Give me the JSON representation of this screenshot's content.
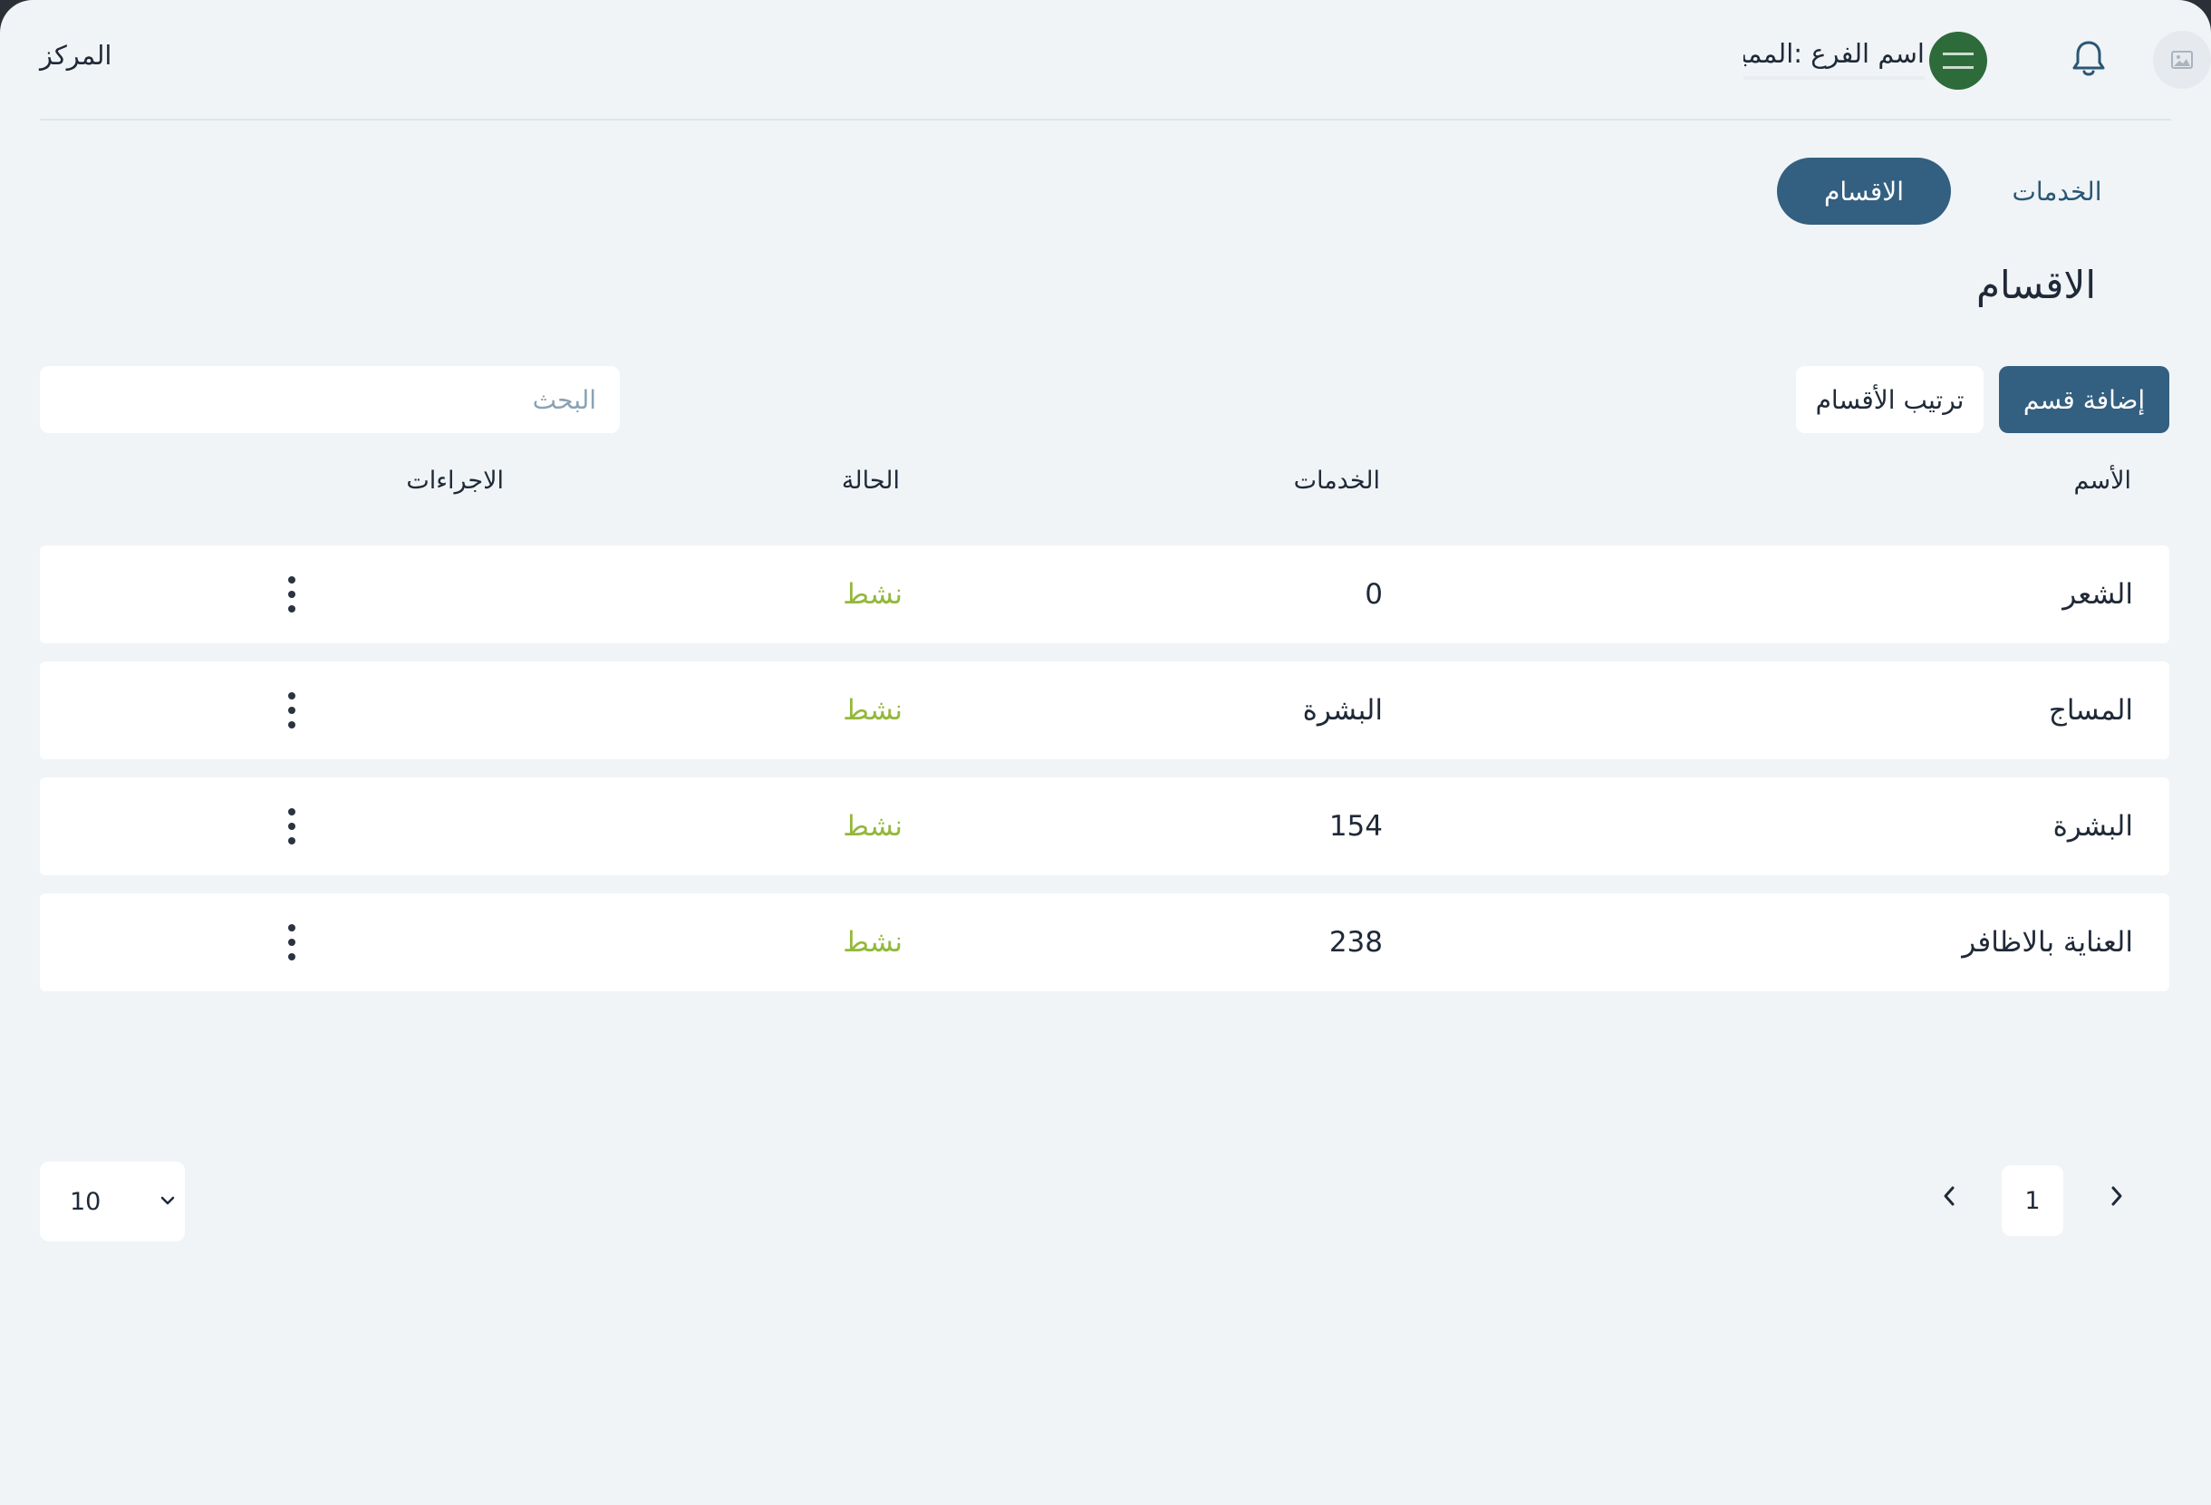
{
  "header": {
    "brand": "المركز",
    "branch_label": "اسم الفرع :المميز",
    "flag_icon": "saudi-flag-icon",
    "notification_icon": "bell-icon",
    "avatar_icon": "image-placeholder-icon"
  },
  "tabs": [
    {
      "label": "الاقسام",
      "active": true
    },
    {
      "label": "الخدمات",
      "active": false
    }
  ],
  "page_title": "الاقسام",
  "actions": {
    "add_label": "إضافة قسم",
    "sort_label": "ترتيب الأقسام",
    "search_placeholder": "البحث"
  },
  "table": {
    "headers": {
      "name": "الأسم",
      "services": "الخدمات",
      "status": "الحالة",
      "actions": "الاجراءات"
    },
    "rows": [
      {
        "name": "الشعر",
        "services": "0",
        "status": "نشط"
      },
      {
        "name": "المساج",
        "services": "البشرة",
        "status": "نشط"
      },
      {
        "name": "البشرة",
        "services": "154",
        "status": "نشط"
      },
      {
        "name": "العناية بالاظافر",
        "services": "238",
        "status": "نشط"
      }
    ]
  },
  "pagination": {
    "current_page": "1",
    "per_page": "10"
  },
  "colors": {
    "primary": "#335f80",
    "status_active": "#93b83c",
    "background": "#f0f4f7",
    "card": "#ffffff"
  }
}
